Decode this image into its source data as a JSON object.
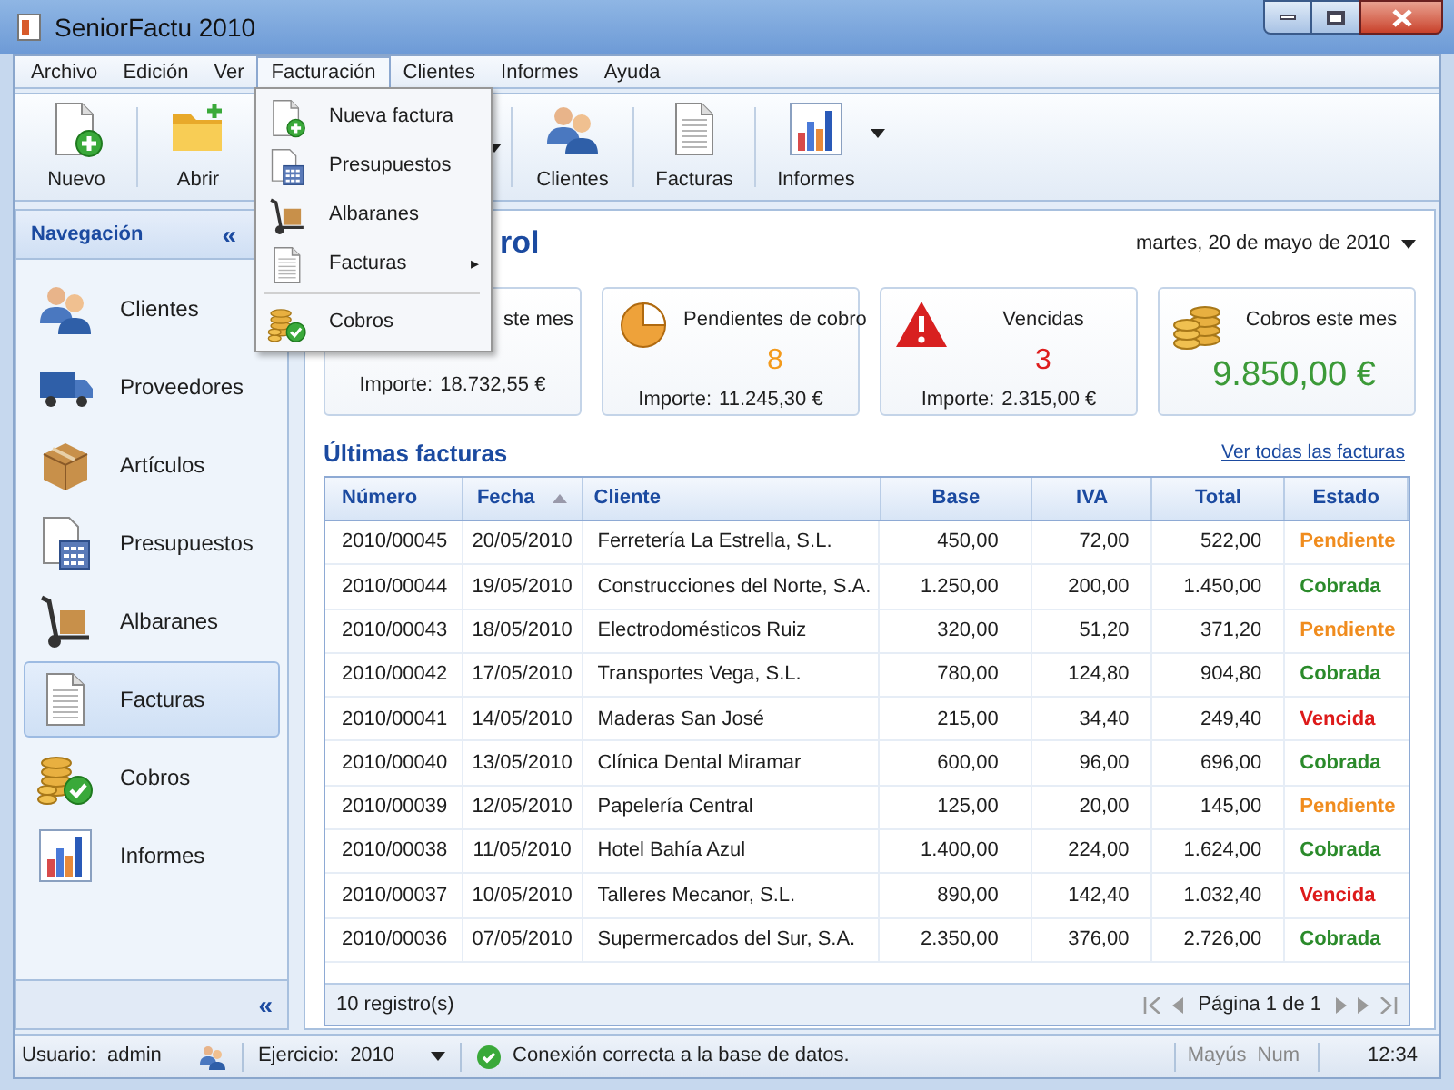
{
  "window": {
    "title": "SeniorFactu 2010"
  },
  "menu_bar": [
    {
      "label": "Archivo",
      "selected": false
    },
    {
      "label": "Edición",
      "selected": false
    },
    {
      "label": "Ver",
      "selected": false
    },
    {
      "label": "Facturación",
      "selected": true
    },
    {
      "label": "Clientes",
      "selected": false
    },
    {
      "label": "Informes",
      "selected": false
    },
    {
      "label": "Ayuda",
      "selected": false
    }
  ],
  "dropdown_menu": [
    {
      "kind": "item",
      "label": "Nueva factura"
    },
    {
      "kind": "item",
      "label": "Presupuestos"
    },
    {
      "kind": "item",
      "label": "Albaranes"
    },
    {
      "kind": "submenu",
      "label": "Facturas",
      "arrow": "▸"
    },
    {
      "kind": "separator"
    },
    {
      "kind": "item",
      "label": "Cobros"
    }
  ],
  "toolbar": [
    {
      "kind": "button",
      "label": "Nuevo"
    },
    {
      "kind": "button",
      "label": "Abrir"
    },
    {
      "kind": "hidden"
    },
    {
      "kind": "button",
      "label": "Clientes"
    },
    {
      "kind": "button",
      "label": "Facturas"
    },
    {
      "kind": "dropdown",
      "label": "Informes"
    }
  ],
  "sidebar": {
    "title": "Navegación",
    "collapse": "«",
    "footer_collapse": "«",
    "items": [
      {
        "label": "Clientes",
        "selected": false
      },
      {
        "label": "Proveedores",
        "selected": false
      },
      {
        "label": "Artículos",
        "selected": false
      },
      {
        "label": "Presupuestos",
        "selected": false
      },
      {
        "label": "Albaranes",
        "selected": false
      },
      {
        "label": "Facturas",
        "selected": true
      },
      {
        "label": "Cobros",
        "selected": false
      },
      {
        "label": "Informes",
        "selected": false
      }
    ]
  },
  "main": {
    "title": "rol",
    "date": "martes, 20 de mayo de 2010",
    "cards": [
      {
        "label": "ste mes",
        "importe_label": "Importe:",
        "importe": "18.732,55 €"
      },
      {
        "label": "Pendientes de cobro",
        "value": "8",
        "color": "#f39a1c",
        "importe_label": "Importe:",
        "importe": "11.245,30 €"
      },
      {
        "label": "Vencidas",
        "value": "3",
        "color": "#de1d1d",
        "importe_label": "Importe:",
        "importe": "2.315,00 €"
      },
      {
        "label": "Cobros este mes",
        "value": "9.850,00 €",
        "color": "#3c9a38"
      }
    ],
    "section_title": "Últimas facturas",
    "view_all_link": "Ver todas las facturas",
    "table": {
      "columns": [
        {
          "label": "Número",
          "sorted": false
        },
        {
          "label": "Fecha",
          "sorted": true
        },
        {
          "label": "Cliente",
          "sorted": false
        },
        {
          "label": "Base",
          "sorted": false
        },
        {
          "label": "IVA",
          "sorted": false
        },
        {
          "label": "Total",
          "sorted": false
        },
        {
          "label": "Estado",
          "sorted": false
        }
      ],
      "rows": [
        {
          "numero": "2010/00045",
          "fecha": "20/05/2010",
          "cliente": "Ferretería La Estrella, S.L.",
          "base": "450,00",
          "iva": "72,00",
          "total": "522,00",
          "estado": "Pendiente",
          "color": "#f08c1e"
        },
        {
          "numero": "2010/00044",
          "fecha": "19/05/2010",
          "cliente": "Construcciones del Norte, S.A.",
          "base": "1.250,00",
          "iva": "200,00",
          "total": "1.450,00",
          "estado": "Cobrada",
          "color": "#2a8a2a"
        },
        {
          "numero": "2010/00043",
          "fecha": "18/05/2010",
          "cliente": "Electrodomésticos Ruiz",
          "base": "320,00",
          "iva": "51,20",
          "total": "371,20",
          "estado": "Pendiente",
          "color": "#f08c1e"
        },
        {
          "numero": "2010/00042",
          "fecha": "17/05/2010",
          "cliente": "Transportes Vega, S.L.",
          "base": "780,00",
          "iva": "124,80",
          "total": "904,80",
          "estado": "Cobrada",
          "color": "#2a8a2a"
        },
        {
          "numero": "2010/00041",
          "fecha": "14/05/2010",
          "cliente": "Maderas San José",
          "base": "215,00",
          "iva": "34,40",
          "total": "249,40",
          "estado": "Vencida",
          "color": "#dd1a1a"
        },
        {
          "numero": "2010/00040",
          "fecha": "13/05/2010",
          "cliente": "Clínica Dental Miramar",
          "base": "600,00",
          "iva": "96,00",
          "total": "696,00",
          "estado": "Cobrada",
          "color": "#2a8a2a"
        },
        {
          "numero": "2010/00039",
          "fecha": "12/05/2010",
          "cliente": "Papelería Central",
          "base": "125,00",
          "iva": "20,00",
          "total": "145,00",
          "estado": "Pendiente",
          "color": "#f08c1e"
        },
        {
          "numero": "2010/00038",
          "fecha": "11/05/2010",
          "cliente": "Hotel Bahía Azul",
          "base": "1.400,00",
          "iva": "224,00",
          "total": "1.624,00",
          "estado": "Cobrada",
          "color": "#2a8a2a"
        },
        {
          "numero": "2010/00037",
          "fecha": "10/05/2010",
          "cliente": "Talleres Mecanor, S.L.",
          "base": "890,00",
          "iva": "142,40",
          "total": "1.032,40",
          "estado": "Vencida",
          "color": "#dd1a1a"
        },
        {
          "numero": "2010/00036",
          "fecha": "07/05/2010",
          "cliente": "Supermercados del Sur, S.A.",
          "base": "2.350,00",
          "iva": "376,00",
          "total": "2.726,00",
          "estado": "Cobrada",
          "color": "#2a8a2a"
        }
      ],
      "footer": "10 registro(s)",
      "pagination": "Página 1 de 1"
    }
  },
  "status_bar": {
    "user_label": "Usuario:",
    "user": "admin",
    "year_label": "Ejercicio:",
    "year": "2010",
    "message": "Conexión correcta a la base de datos.",
    "caps": "Mayús",
    "num": "Num",
    "time": "12:34"
  }
}
